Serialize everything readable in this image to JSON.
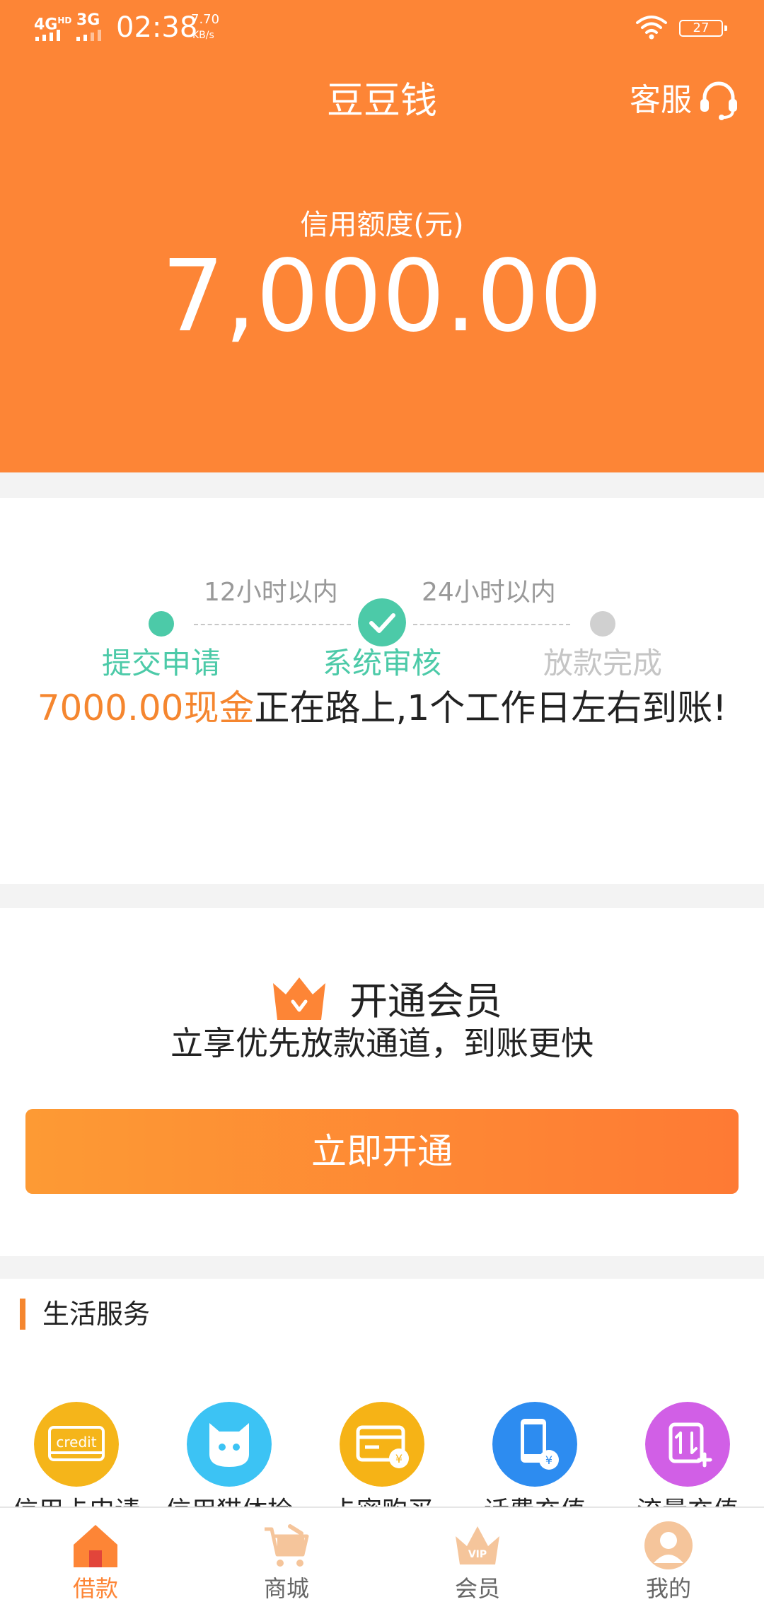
{
  "status_bar": {
    "network1": "4G",
    "network1_sup": "HD",
    "network2": "3G",
    "time": "02:38",
    "speed_value": "7.70",
    "speed_unit": "KB/s",
    "battery": "27"
  },
  "header": {
    "title": "豆豆钱",
    "service_label": "客服"
  },
  "credit": {
    "label": "信用额度(元)",
    "value": "7,000.00"
  },
  "progress": {
    "durations": [
      "12小时以内",
      "24小时以内"
    ],
    "steps": [
      {
        "label": "提交申请",
        "state": "done"
      },
      {
        "label": "系统审核",
        "state": "current"
      },
      {
        "label": "放款完成",
        "state": "pending"
      }
    ],
    "message_highlight": "7000.00现金",
    "message_rest": "正在路上,1个工作日左右到账!"
  },
  "membership": {
    "title": "开通会员",
    "subtitle": "立享优先放款通道，到账更快",
    "button": "立即开通"
  },
  "life_services": {
    "title": "生活服务",
    "items": [
      {
        "label": "信用卡申请",
        "icon": "credit-card-icon",
        "badge_text": "credit",
        "color": "#f5b51a"
      },
      {
        "label": "信用猫体检",
        "icon": "cat-icon",
        "color": "#3cc3f4"
      },
      {
        "label": "卡密购买",
        "icon": "card-yen-icon",
        "color": "#f6b316"
      },
      {
        "label": "话费充值",
        "icon": "phone-yen-icon",
        "color": "#2d8cf0"
      },
      {
        "label": "流量充值",
        "icon": "data-plus-icon",
        "color": "#d15fe6"
      }
    ]
  },
  "tabbar": {
    "items": [
      {
        "label": "借款",
        "icon": "home-icon",
        "active": true
      },
      {
        "label": "商城",
        "icon": "cart-icon",
        "active": false
      },
      {
        "label": "会员",
        "icon": "vip-crown-icon",
        "active": false
      },
      {
        "label": "我的",
        "icon": "user-icon",
        "active": false
      }
    ]
  },
  "colors": {
    "brand_orange": "#fd8536",
    "step_green": "#4ccaa8",
    "highlight_orange": "#f5862f"
  }
}
